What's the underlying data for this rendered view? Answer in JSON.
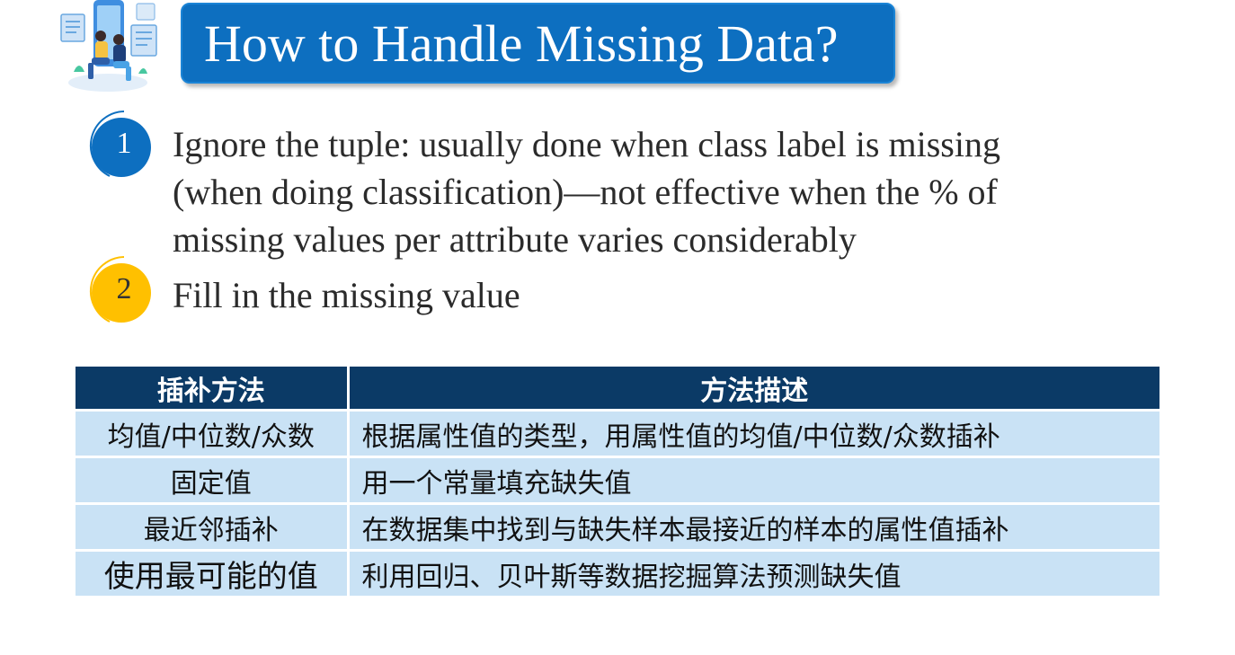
{
  "title": "How to Handle Missing Data?",
  "items": [
    {
      "number": "1",
      "lines": [
        "Ignore the tuple: usually done when class label is missing",
        "(when doing classification)—not effective when the % of",
        "missing values per attribute varies considerably"
      ],
      "color": "#0d6fc0"
    },
    {
      "number": "2",
      "lines": [
        "Fill in the missing value"
      ],
      "color": "#ffc000"
    }
  ],
  "table": {
    "headers": [
      "插补方法",
      "方法描述"
    ],
    "rows": [
      [
        "均值/中位数/众数",
        "根据属性值的类型，用属性值的均值/中位数/众数插补"
      ],
      [
        "固定值",
        "用一个常量填充缺失值"
      ],
      [
        "最近邻插补",
        "在数据集中找到与缺失样本最接近的样本的属性值插补"
      ],
      [
        "使用最可能的值",
        "利用回归、贝叶斯等数据挖掘算法预测缺失值"
      ]
    ],
    "header_color": "#0b3a66",
    "row_color": "#c9e2f5"
  }
}
